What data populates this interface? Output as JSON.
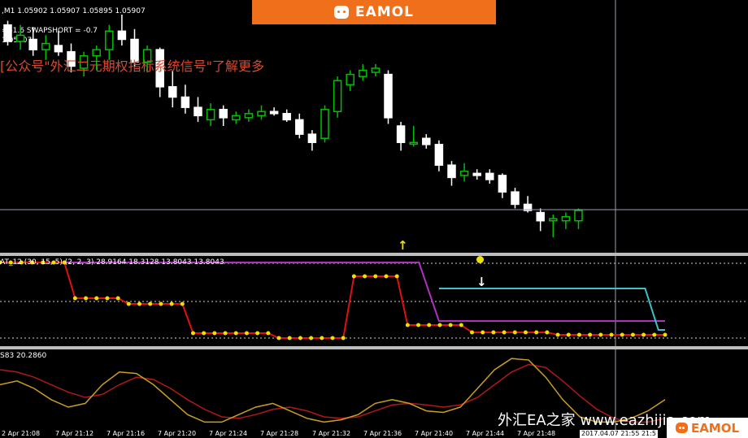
{
  "header": {
    "symbol_line": ",M1  1.05902 1.05907 1.05895 1.05907",
    "indicator_line": "= -1.6  SWAPSHORT = -0.7",
    "price_line": "1.05907",
    "chinese_note": "[公众号\"外汇二元期权指标系统信号\"了解更多"
  },
  "banner": {
    "logo_text": "EAMOL"
  },
  "indicator1": {
    "label": "AT_12 (30, 15, 5) (2, 2, 3)   28.9164 18.3128 13.8043 13.8043"
  },
  "indicator2": {
    "label": "S83 20.2860"
  },
  "time_axis": [
    "2 Apr 21:08",
    "7 Apr 21:12",
    "7 Apr 21:16",
    "7 Apr 21:20",
    "7 Apr 21:24",
    "7 Apr 21:28",
    "7 Apr 21:32",
    "7 Apr 21:36",
    "7 Apr 21:40",
    "7 Apr 21:44",
    "7 Apr 21:48",
    "7 Apr 21:52"
  ],
  "cursor_date": "2017.04.07 21:55 21:5",
  "watermark": {
    "text": "外汇EA之家 www.eazhijia.com",
    "logo_text": "EAMOL"
  },
  "signals": {
    "up_arrow": "↑",
    "down_arrow": "↓"
  },
  "colors": {
    "bull": "#00c000",
    "bear": "#ffffff",
    "red": "#e01010",
    "purple": "#b030c0",
    "cyan": "#40c0c8",
    "yellow": "#f0e000",
    "gold": "#c8a020",
    "darkred": "#b01818",
    "brand": "#ef6f1b"
  },
  "candles": [
    {
      "o": 1.05915,
      "h": 1.05917,
      "l": 1.05905,
      "c": 1.05907
    },
    {
      "o": 1.05907,
      "h": 1.05915,
      "l": 1.05903,
      "c": 1.0591
    },
    {
      "o": 1.05908,
      "h": 1.05914,
      "l": 1.059,
      "c": 1.05903
    },
    {
      "o": 1.05903,
      "h": 1.0591,
      "l": 1.05898,
      "c": 1.05906
    },
    {
      "o": 1.05905,
      "h": 1.05912,
      "l": 1.059,
      "c": 1.05902
    },
    {
      "o": 1.05902,
      "h": 1.05906,
      "l": 1.05892,
      "c": 1.05895
    },
    {
      "o": 1.05894,
      "h": 1.05902,
      "l": 1.0589,
      "c": 1.059
    },
    {
      "o": 1.059,
      "h": 1.05905,
      "l": 1.05893,
      "c": 1.05903
    },
    {
      "o": 1.05903,
      "h": 1.05915,
      "l": 1.05898,
      "c": 1.05912
    },
    {
      "o": 1.05912,
      "h": 1.0592,
      "l": 1.05905,
      "c": 1.05908
    },
    {
      "o": 1.05908,
      "h": 1.05913,
      "l": 1.05895,
      "c": 1.05897
    },
    {
      "o": 1.05897,
      "h": 1.05905,
      "l": 1.05892,
      "c": 1.05903
    },
    {
      "o": 1.05903,
      "h": 1.05904,
      "l": 1.0588,
      "c": 1.05885
    },
    {
      "o": 1.05885,
      "h": 1.05893,
      "l": 1.05875,
      "c": 1.0588
    },
    {
      "o": 1.0588,
      "h": 1.05886,
      "l": 1.05872,
      "c": 1.05875
    },
    {
      "o": 1.05875,
      "h": 1.0588,
      "l": 1.05868,
      "c": 1.05871
    },
    {
      "o": 1.05869,
      "h": 1.05877,
      "l": 1.05866,
      "c": 1.05874
    },
    {
      "o": 1.05874,
      "h": 1.05876,
      "l": 1.05866,
      "c": 1.0587
    },
    {
      "o": 1.05869,
      "h": 1.05873,
      "l": 1.05867,
      "c": 1.05871
    },
    {
      "o": 1.0587,
      "h": 1.05874,
      "l": 1.05868,
      "c": 1.05872
    },
    {
      "o": 1.05871,
      "h": 1.05876,
      "l": 1.05869,
      "c": 1.05873
    },
    {
      "o": 1.05873,
      "h": 1.05875,
      "l": 1.05871,
      "c": 1.05872
    },
    {
      "o": 1.05872,
      "h": 1.05874,
      "l": 1.05868,
      "c": 1.05869
    },
    {
      "o": 1.05869,
      "h": 1.05872,
      "l": 1.0586,
      "c": 1.05862
    },
    {
      "o": 1.05862,
      "h": 1.05864,
      "l": 1.05854,
      "c": 1.05858
    },
    {
      "o": 1.0586,
      "h": 1.05876,
      "l": 1.05858,
      "c": 1.05874
    },
    {
      "o": 1.05873,
      "h": 1.0589,
      "l": 1.0587,
      "c": 1.05888
    },
    {
      "o": 1.05886,
      "h": 1.05893,
      "l": 1.05883,
      "c": 1.05891
    },
    {
      "o": 1.0589,
      "h": 1.05896,
      "l": 1.05888,
      "c": 1.05893
    },
    {
      "o": 1.05892,
      "h": 1.05896,
      "l": 1.0589,
      "c": 1.05894
    },
    {
      "o": 1.05891,
      "h": 1.05893,
      "l": 1.05867,
      "c": 1.0587
    },
    {
      "o": 1.05866,
      "h": 1.05868,
      "l": 1.05854,
      "c": 1.05858
    },
    {
      "o": 1.05858,
      "h": 1.05866,
      "l": 1.05856,
      "c": 1.05858
    },
    {
      "o": 1.0586,
      "h": 1.05862,
      "l": 1.05855,
      "c": 1.05857
    },
    {
      "o": 1.05857,
      "h": 1.05859,
      "l": 1.05844,
      "c": 1.05847
    },
    {
      "o": 1.05847,
      "h": 1.05849,
      "l": 1.05837,
      "c": 1.05841
    },
    {
      "o": 1.05842,
      "h": 1.05848,
      "l": 1.05839,
      "c": 1.05844
    },
    {
      "o": 1.05843,
      "h": 1.05845,
      "l": 1.0584,
      "c": 1.05842
    },
    {
      "o": 1.05843,
      "h": 1.05845,
      "l": 1.05838,
      "c": 1.0584
    },
    {
      "o": 1.05842,
      "h": 1.05843,
      "l": 1.05831,
      "c": 1.05834
    },
    {
      "o": 1.05834,
      "h": 1.05836,
      "l": 1.05826,
      "c": 1.05828
    },
    {
      "o": 1.05828,
      "h": 1.05832,
      "l": 1.05824,
      "c": 1.05825
    },
    {
      "o": 1.05824,
      "h": 1.05826,
      "l": 1.05815,
      "c": 1.0582
    },
    {
      "o": 1.0582,
      "h": 1.05823,
      "l": 1.05812,
      "c": 1.05821
    },
    {
      "o": 1.0582,
      "h": 1.05824,
      "l": 1.05816,
      "c": 1.05822
    },
    {
      "o": 1.0582,
      "h": 1.05826,
      "l": 1.05816,
      "c": 1.05825
    }
  ],
  "signal_line": [
    0.97,
    0.97,
    0.97,
    0.97,
    0.97,
    0.97,
    0.97,
    0.53,
    0.53,
    0.53,
    0.53,
    0.53,
    0.46,
    0.46,
    0.46,
    0.46,
    0.46,
    0.46,
    0.1,
    0.1,
    0.1,
    0.1,
    0.1,
    0.1,
    0.1,
    0.1,
    0.04,
    0.04,
    0.04,
    0.04,
    0.04,
    0.04,
    0.04,
    0.8,
    0.8,
    0.8,
    0.8,
    0.8,
    0.2,
    0.2,
    0.2,
    0.2,
    0.2,
    0.2,
    0.11,
    0.11,
    0.11,
    0.11,
    0.11,
    0.11,
    0.11,
    0.11,
    0.08,
    0.08,
    0.08,
    0.08,
    0.08,
    0.08,
    0.08,
    0.08,
    0.08,
    0.08,
    0.08
  ],
  "purple_line": [
    [
      0,
      0.97
    ],
    [
      0.63,
      0.97
    ],
    [
      0.66,
      0.25
    ],
    [
      1.0,
      0.25
    ]
  ],
  "cyan_line": [
    [
      0.66,
      0.65
    ],
    [
      0.7,
      0.65
    ],
    [
      0.97,
      0.65
    ],
    [
      0.99,
      0.14
    ],
    [
      1.0,
      0.14
    ]
  ],
  "osc_fast": [
    0.55,
    0.6,
    0.5,
    0.35,
    0.25,
    0.3,
    0.55,
    0.72,
    0.7,
    0.55,
    0.35,
    0.15,
    0.05,
    0.05,
    0.15,
    0.25,
    0.3,
    0.2,
    0.1,
    0.05,
    0.08,
    0.15,
    0.3,
    0.35,
    0.3,
    0.2,
    0.18,
    0.25,
    0.5,
    0.75,
    0.9,
    0.88,
    0.65,
    0.35,
    0.12,
    0.05,
    0.05,
    0.1,
    0.2,
    0.35
  ],
  "osc_slow": [
    0.75,
    0.72,
    0.65,
    0.55,
    0.45,
    0.38,
    0.42,
    0.55,
    0.65,
    0.62,
    0.5,
    0.35,
    0.22,
    0.12,
    0.1,
    0.15,
    0.22,
    0.25,
    0.2,
    0.12,
    0.1,
    0.12,
    0.2,
    0.28,
    0.3,
    0.28,
    0.25,
    0.28,
    0.38,
    0.55,
    0.72,
    0.82,
    0.78,
    0.6,
    0.4,
    0.22,
    0.1,
    0.05,
    0.05,
    0.1
  ]
}
